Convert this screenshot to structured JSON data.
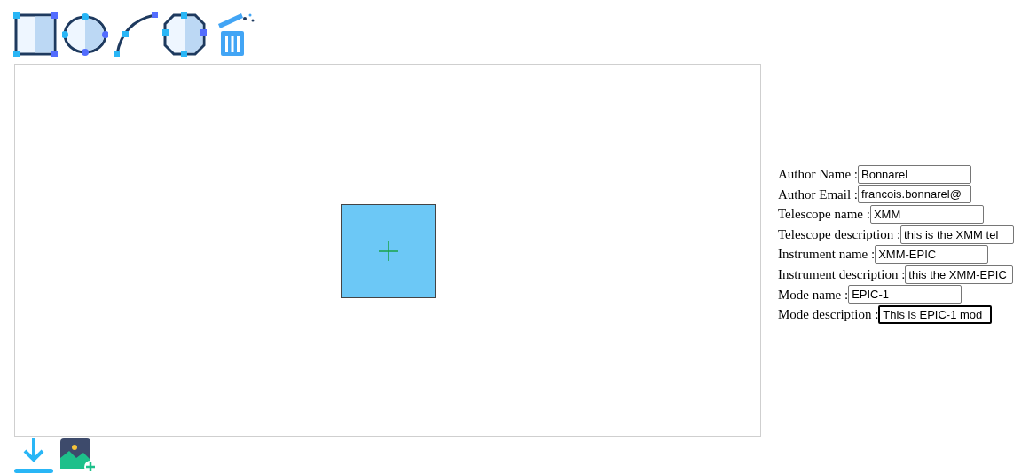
{
  "fields": [
    {
      "label": "Author Name :",
      "value": "Bonnarel",
      "focused": false
    },
    {
      "label": "Author Email :",
      "value": "francois.bonnarel@",
      "focused": false
    },
    {
      "label": "Telescope name :",
      "value": "XMM",
      "focused": false
    },
    {
      "label": "Telescope description :",
      "value": "this is the XMM tel",
      "focused": false
    },
    {
      "label": "Instrument name :",
      "value": "XMM-EPIC",
      "focused": false
    },
    {
      "label": "Instrument description :",
      "value": "this the XMM-EPIC",
      "focused": false
    },
    {
      "label": "Mode name :",
      "value": "EPIC-1",
      "focused": false
    },
    {
      "label": "Mode description :",
      "value": "This is EPIC-1 mod",
      "focused": true
    }
  ]
}
